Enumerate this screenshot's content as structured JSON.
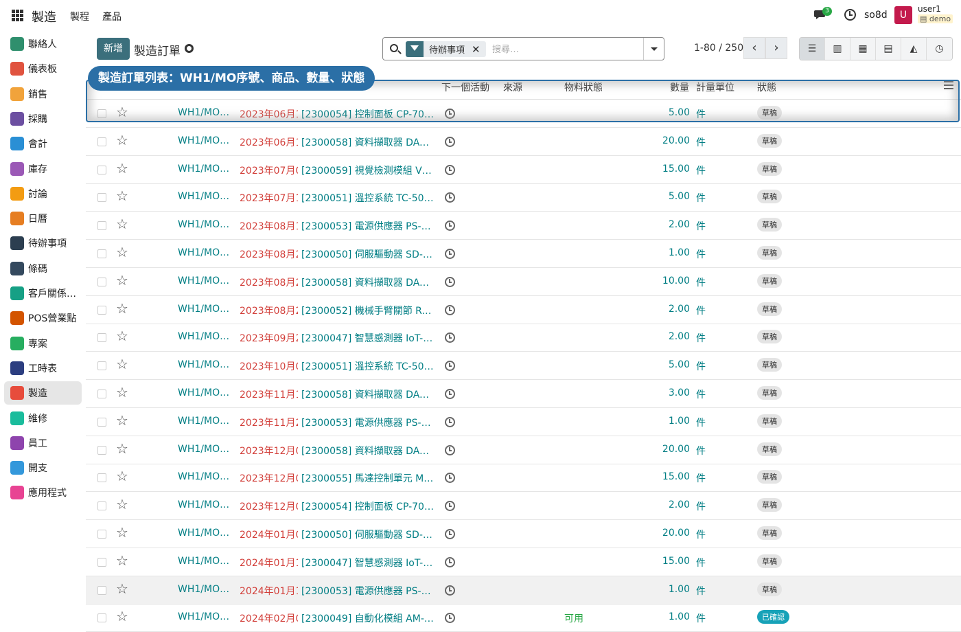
{
  "topbar": {
    "app_title": "製造",
    "menu": [
      "製程",
      "產品"
    ],
    "chat_badge": "3",
    "db_name": "so8d",
    "avatar_letter": "U",
    "user_name": "user1",
    "db_tag": "demo"
  },
  "sidebar": {
    "items": [
      {
        "label": "聯絡人",
        "color": "#2f8f6d"
      },
      {
        "label": "儀表板",
        "color": "#e0533f"
      },
      {
        "label": "銷售",
        "color": "#f1a33b"
      },
      {
        "label": "採購",
        "color": "#6c4fa1"
      },
      {
        "label": "會計",
        "color": "#2a8fd5"
      },
      {
        "label": "庫存",
        "color": "#9b59b6"
      },
      {
        "label": "討論",
        "color": "#f39c12"
      },
      {
        "label": "日曆",
        "color": "#e67e22"
      },
      {
        "label": "待辦事項",
        "color": "#2c3e50"
      },
      {
        "label": "條碼",
        "color": "#34495e"
      },
      {
        "label": "客戶關係…",
        "color": "#16a085"
      },
      {
        "label": "POS營業點",
        "color": "#d35400"
      },
      {
        "label": "專案",
        "color": "#27ae60"
      },
      {
        "label": "工時表",
        "color": "#2c3e80"
      },
      {
        "label": "製造",
        "color": "#e74c3c"
      },
      {
        "label": "維修",
        "color": "#1abc9c"
      },
      {
        "label": "員工",
        "color": "#8e44ad"
      },
      {
        "label": "開支",
        "color": "#3498db"
      },
      {
        "label": "應用程式",
        "color": "#e84393"
      }
    ],
    "active_index": 14
  },
  "control": {
    "new_label": "新增",
    "breadcrumb": "製造訂單",
    "facet_label": "待辦事項",
    "search_placeholder": "搜尋…",
    "pager": "1-80 / 250"
  },
  "annotation": {
    "callout": "製造訂單列表：WH1/MO序號、商品、數量、狀態"
  },
  "table": {
    "headers": {
      "next_activity": "下一個活動",
      "source": "來源",
      "material_state": "物料狀態",
      "quantity": "數量",
      "uom": "計量單位",
      "state": "狀態"
    },
    "rows": [
      {
        "ref": "WH1/MO/…",
        "date": "2023年06月1",
        "product": "[2300054] 控制面板 CP-700…",
        "qty": "5.00",
        "uom": "件",
        "mat": "",
        "state": "草稿"
      },
      {
        "ref": "WH1/MO/…",
        "date": "2023年06月1",
        "product": "[2300058] 資料擷取器 DAQ-1…",
        "qty": "20.00",
        "uom": "件",
        "mat": "",
        "state": "草稿"
      },
      {
        "ref": "WH1/MO/…",
        "date": "2023年07月0",
        "product": "[2300059] 視覺檢測模組 VM-…",
        "qty": "15.00",
        "uom": "件",
        "mat": "",
        "state": "草稿"
      },
      {
        "ref": "WH1/MO/…",
        "date": "2023年07月1",
        "product": "[2300051] 溫控系統 TC-500…",
        "qty": "5.00",
        "uom": "件",
        "mat": "",
        "state": "草稿"
      },
      {
        "ref": "WH1/MO/…",
        "date": "2023年08月1",
        "product": "[2300053] 電源供應器 PS-600…",
        "qty": "2.00",
        "uom": "件",
        "mat": "",
        "state": "草稿"
      },
      {
        "ref": "WH1/MO/…",
        "date": "2023年08月2",
        "product": "[2300050] 伺服驅動器 SD-400…",
        "qty": "1.00",
        "uom": "件",
        "mat": "",
        "state": "草稿"
      },
      {
        "ref": "WH1/MO/…",
        "date": "2023年08月2",
        "product": "[2300058] 資料擷取器 DAQ-1…",
        "qty": "10.00",
        "uom": "件",
        "mat": "",
        "state": "草稿"
      },
      {
        "ref": "WH1/MO/…",
        "date": "2023年08月2",
        "product": "[2300052] 機械手臂關節 RA-J…",
        "qty": "2.00",
        "uom": "件",
        "mat": "",
        "state": "草稿"
      },
      {
        "ref": "WH1/MO/…",
        "date": "2023年09月2",
        "product": "[2300047] 智慧感測器 IoT-S1…",
        "qty": "2.00",
        "uom": "件",
        "mat": "",
        "state": "草稿"
      },
      {
        "ref": "WH1/MO/…",
        "date": "2023年10月0",
        "product": "[2300051] 溫控系統 TC-500…",
        "qty": "5.00",
        "uom": "件",
        "mat": "",
        "state": "草稿"
      },
      {
        "ref": "WH1/MO/…",
        "date": "2023年11月1",
        "product": "[2300058] 資料擷取器 DAQ-1…",
        "qty": "3.00",
        "uom": "件",
        "mat": "",
        "state": "草稿"
      },
      {
        "ref": "WH1/MO/…",
        "date": "2023年11月2",
        "product": "[2300053] 電源供應器 PS-600…",
        "qty": "1.00",
        "uom": "件",
        "mat": "",
        "state": "草稿"
      },
      {
        "ref": "WH1/MO/…",
        "date": "2023年12月0",
        "product": "[2300058] 資料擷取器 DAQ-1…",
        "qty": "20.00",
        "uom": "件",
        "mat": "",
        "state": "草稿"
      },
      {
        "ref": "WH1/MO/…",
        "date": "2023年12月0",
        "product": "[2300055] 馬達控制單元 MCU…",
        "qty": "15.00",
        "uom": "件",
        "mat": "",
        "state": "草稿"
      },
      {
        "ref": "WH1/MO/…",
        "date": "2023年12月0",
        "product": "[2300054] 控制面板 CP-700…",
        "qty": "2.00",
        "uom": "件",
        "mat": "",
        "state": "草稿"
      },
      {
        "ref": "WH1/MO/…",
        "date": "2024年01月0",
        "product": "[2300050] 伺服驅動器 SD-400…",
        "qty": "20.00",
        "uom": "件",
        "mat": "",
        "state": "草稿"
      },
      {
        "ref": "WH1/MO/…",
        "date": "2024年01月1",
        "product": "[2300047] 智慧感測器 IoT-S1…",
        "qty": "15.00",
        "uom": "件",
        "mat": "",
        "state": "草稿"
      },
      {
        "ref": "WH1/MO/…",
        "date": "2024年01月1",
        "product": "[2300053] 電源供應器 PS-600…",
        "qty": "1.00",
        "uom": "件",
        "mat": "",
        "state": "草稿"
      },
      {
        "ref": "WH1/MO/…",
        "date": "2024年02月0",
        "product": "[2300049] 自動化模組 AM-30…",
        "qty": "1.00",
        "uom": "件",
        "mat": "可用",
        "state": "已確認"
      }
    ]
  }
}
